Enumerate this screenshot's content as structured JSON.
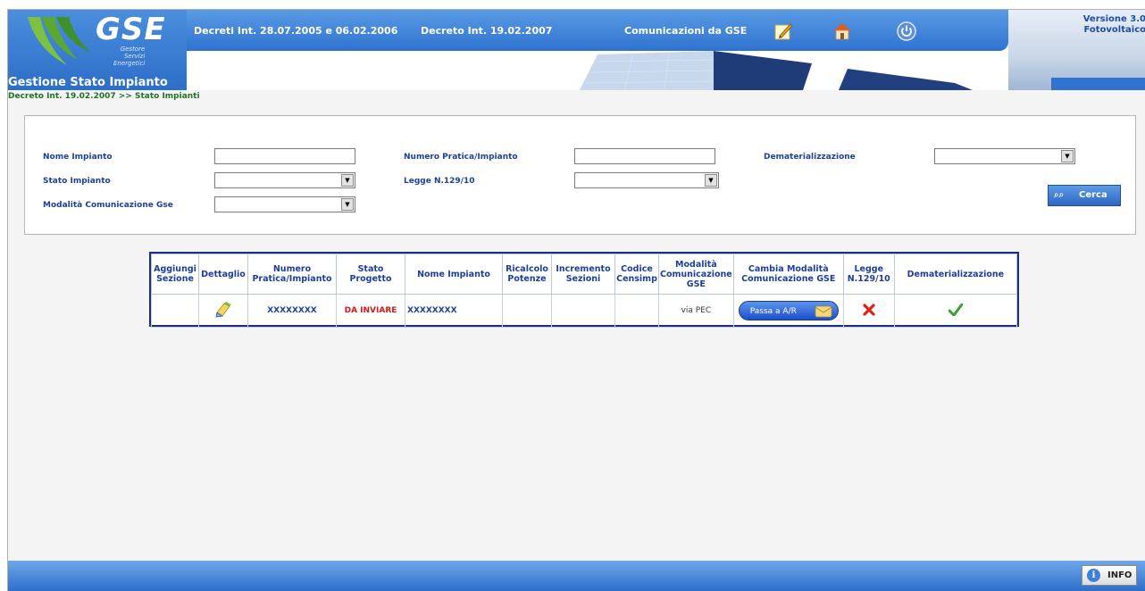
{
  "header": {
    "logo_text": "GSE",
    "logo_subtitle": [
      "Gestore",
      "Servizi",
      "Energetici"
    ],
    "app_title": "Gestione Stato Impianto",
    "nav": [
      {
        "label": "Decreti Int. 28.07.2005 e 06.02.2006"
      },
      {
        "label": "Decreto Int. 19.02.2007"
      },
      {
        "label": "Comunicazioni da GSE"
      }
    ],
    "icons": [
      "edit-note-icon",
      "home-icon",
      "power-icon"
    ],
    "version_line1": "Versione 3.0",
    "version_line2": "Fotovoltaico"
  },
  "breadcrumb": "Decreto Int. 19.02.2007 >> Stato Impianti",
  "filters": {
    "nome_impianto_label": "Nome Impianto",
    "nome_impianto_value": "",
    "numero_pratica_label": "Numero Pratica/Impianto",
    "numero_pratica_value": "",
    "dematerializzazione_label": "Dematerializzazione",
    "dematerializzazione_value": "",
    "stato_impianto_label": "Stato Impianto",
    "stato_impianto_value": "",
    "legge_label": "Legge N.129/10",
    "legge_value": "",
    "modalita_label": "Modalità Comunicazione Gse",
    "modalita_value": "",
    "search_button": "Cerca"
  },
  "table": {
    "headers": {
      "aggiungi": "Aggiungi Sezione",
      "dettaglio": "Dettaglio",
      "numero": "Numero Pratica/Impianto",
      "stato": "Stato Progetto",
      "nome": "Nome Impianto",
      "ricalcolo": "Ricalcolo Potenze",
      "incremento": "Incremento Sezioni",
      "codice": "Codice Censimp",
      "modalita": "Modalità Comunicazione GSE",
      "cambia": "Cambia Modalità Comunicazione GSE",
      "legge": "Legge N.129/10",
      "demat": "Dematerializzazione"
    },
    "rows": [
      {
        "aggiungi": "",
        "numero": "XXXXXXXX",
        "stato": "DA INVIARE",
        "nome": "XXXXXXXX",
        "ricalcolo": "",
        "incremento": "",
        "codice": "",
        "modalita": "via PEC",
        "cambia_button": "Passa a A/R",
        "legge": "no",
        "demat": "yes"
      }
    ]
  },
  "footer": {
    "info_button": "INFO"
  },
  "colors": {
    "brand_blue": "#2f73cf",
    "label_blue": "#1c3f9a",
    "status_red": "#d01818",
    "breadcrumb_green": "#217221"
  }
}
